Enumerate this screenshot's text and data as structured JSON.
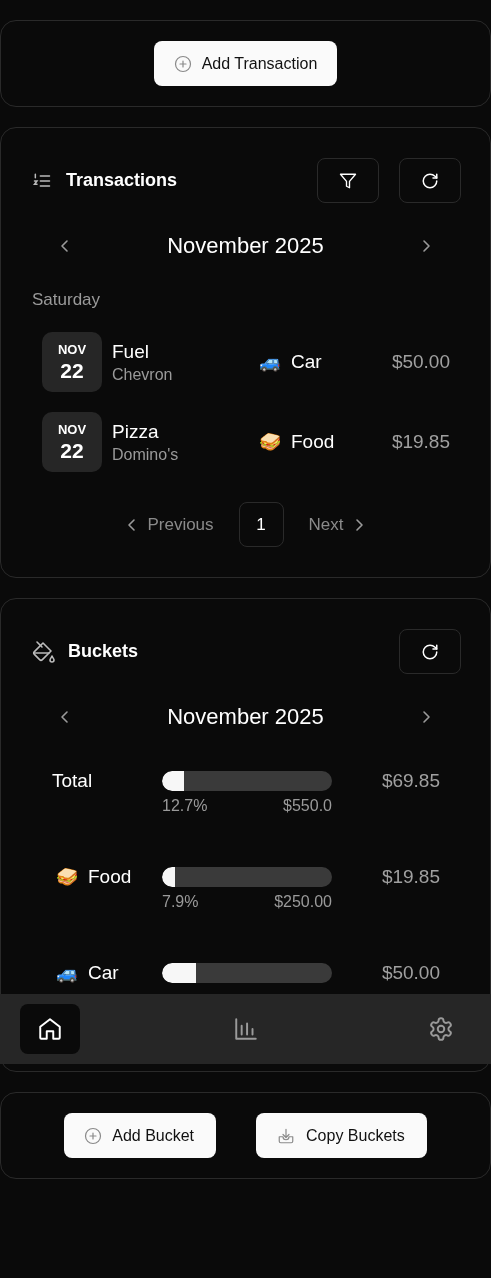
{
  "add_transaction_button": {
    "label": "Add Transaction"
  },
  "transactions": {
    "title": "Transactions",
    "month": "November 2025",
    "day_groups": [
      {
        "day": "Saturday",
        "items": [
          {
            "date_month": "NOV",
            "date_day": "22",
            "name": "Fuel",
            "merchant": "Chevron",
            "category_icon": "🚙",
            "category": "Car",
            "amount": "$50.00"
          },
          {
            "date_month": "NOV",
            "date_day": "22",
            "name": "Pizza",
            "merchant": "Domino's",
            "category_icon": "🥪",
            "category": "Food",
            "amount": "$19.85"
          }
        ]
      }
    ],
    "pagination": {
      "previous": "Previous",
      "pages": [
        {
          "label": "1",
          "selected": true
        }
      ],
      "next": "Next"
    }
  },
  "buckets": {
    "title": "Buckets",
    "month": "November 2025",
    "items": [
      {
        "name": "Total",
        "level": 0.127,
        "percent": "12.7%",
        "budget": "$550.0",
        "spent": "$69.85"
      },
      {
        "icon": "🥪",
        "name": "Food",
        "level": 0.079,
        "percent": "7.9%",
        "budget": "$250.00",
        "spent": "$19.85"
      },
      {
        "icon": "🚙",
        "name": "Car",
        "level": 0.2,
        "spent": "$50.00"
      }
    ]
  },
  "bottom_nav": [
    {
      "kind": "home",
      "selected": true
    },
    {
      "kind": "chart",
      "selected": false
    },
    {
      "kind": "settings",
      "selected": false
    }
  ],
  "bucket_actions": [
    {
      "kind": "add",
      "label": "Add Bucket"
    },
    {
      "kind": "copy",
      "label": "Copy Buckets"
    }
  ]
}
